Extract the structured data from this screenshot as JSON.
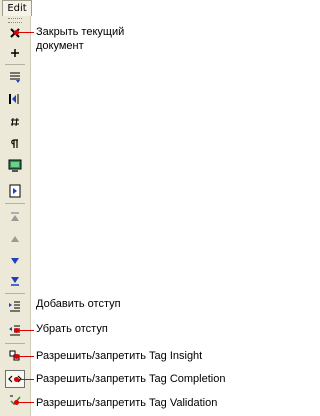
{
  "tab": {
    "label": "Edit"
  },
  "toolbar": {
    "buttons": [
      {
        "name": "close-document-button",
        "icon": "close-x-icon"
      },
      {
        "name": "asterisk-button",
        "icon": "asterisk-icon"
      },
      {
        "name": "list-button",
        "icon": "list-icon"
      },
      {
        "name": "paragraph-align-button",
        "icon": "paragraph-align-icon"
      },
      {
        "name": "hash-button",
        "icon": "hash-icon"
      },
      {
        "name": "pilcrow-button",
        "icon": "pilcrow-icon"
      },
      {
        "name": "preview-button",
        "icon": "monitor-icon"
      },
      {
        "name": "frame-button",
        "icon": "frame-icon"
      },
      {
        "name": "move-top-button",
        "icon": "move-top-icon"
      },
      {
        "name": "move-up-button",
        "icon": "triangle-up-icon"
      },
      {
        "name": "move-down-button",
        "icon": "triangle-down-icon"
      },
      {
        "name": "move-bottom-button",
        "icon": "move-bottom-icon"
      },
      {
        "name": "indent-button",
        "icon": "indent-icon"
      },
      {
        "name": "outdent-button",
        "icon": "outdent-icon"
      },
      {
        "name": "tag-insight-button",
        "icon": "tag-insight-icon"
      },
      {
        "name": "tag-completion-button",
        "icon": "tag-completion-icon"
      },
      {
        "name": "tag-validation-button",
        "icon": "tag-validation-icon"
      }
    ]
  },
  "callouts": {
    "close_doc": "Закрыть текущий документ",
    "add_indent": "Добавить отступ",
    "remove_indent": "Убрать отступ",
    "tag_insight": "Разрешить/запретить Tag Insight",
    "tag_completion": "Разрешить/запретить Tag Completion",
    "tag_validation": "Разрешить/запретить Tag Validation"
  },
  "colors": {
    "toolbar_bg": "#ece9d8",
    "callout_red": "#e00000",
    "icon_blue": "#1f3fbf"
  }
}
